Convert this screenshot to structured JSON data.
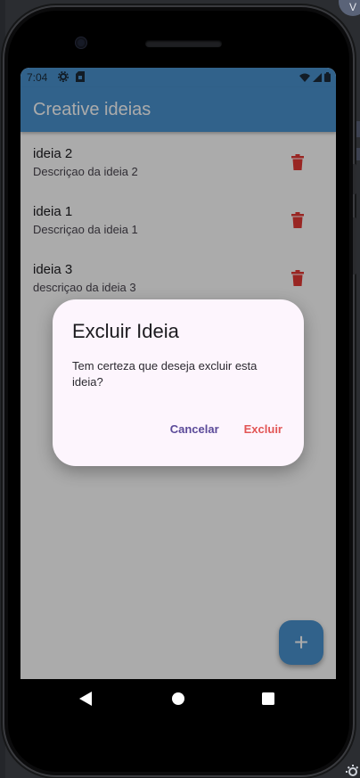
{
  "status_bar": {
    "time": "7:04",
    "icons_left": [
      "gear-icon",
      "sim-card-icon"
    ],
    "icons_right": [
      "wifi-icon",
      "signal-icon",
      "battery-icon"
    ]
  },
  "app_bar": {
    "title": "Creative ideias"
  },
  "ideas": [
    {
      "title": "ideia 2",
      "description": "Descriçao da ideia 2"
    },
    {
      "title": "ideia 1",
      "description": "Descriçao da ideia 1"
    },
    {
      "title": "ideia 3",
      "description": "descriçao da ideia 3"
    }
  ],
  "dialog": {
    "title": "Excluir Ideia",
    "message": "Tem certeza que deseja excluir esta ideia?",
    "cancel_label": "Cancelar",
    "confirm_label": "Excluir"
  },
  "fab": {
    "icon": "plus-icon",
    "label": "+"
  },
  "navigation": {
    "buttons": [
      "back-icon",
      "home-icon",
      "recents-icon"
    ]
  },
  "corner_badge": {
    "label": "V"
  },
  "colors": {
    "primary": "#4a93cf",
    "delete": "#e53935",
    "cancel_text": "#5b4a99",
    "confirm_text": "#e25555",
    "dialog_bg": "#fdf5fd"
  }
}
